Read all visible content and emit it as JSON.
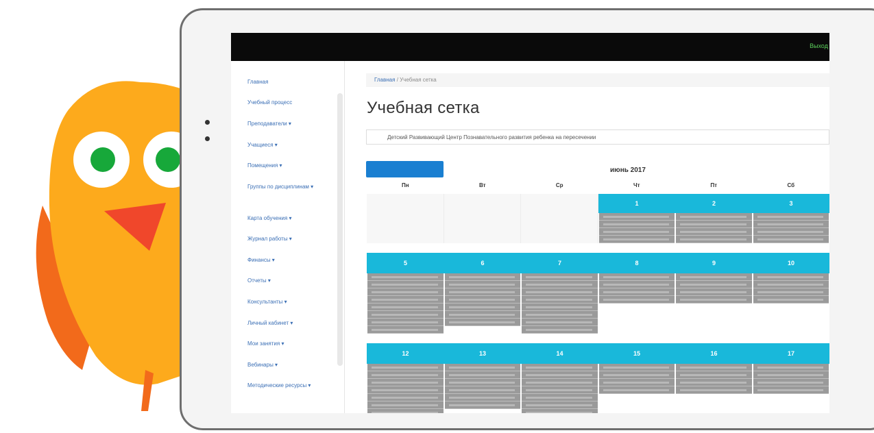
{
  "header": {
    "top_link": "Выход"
  },
  "sidebar": {
    "items": [
      {
        "label": "Главная"
      },
      {
        "label": "Учебный процесс"
      },
      {
        "label": "Преподаватели ▾"
      },
      {
        "label": "Учащиеся ▾"
      },
      {
        "label": "Помещения ▾"
      },
      {
        "label": "Группы по дисциплинам ▾"
      },
      {
        "label": "Карта обучения ▾"
      },
      {
        "label": "Журнал работы ▾"
      },
      {
        "label": "Финансы ▾"
      },
      {
        "label": "Отчеты ▾"
      },
      {
        "label": "Консультанты ▾"
      },
      {
        "label": "Личный кабинет ▾"
      },
      {
        "label": "Мои занятия ▾"
      },
      {
        "label": "Вебинары ▾"
      },
      {
        "label": "Методические ресурсы ▾"
      }
    ]
  },
  "breadcrumb": {
    "home": "Главная",
    "separator": "/",
    "current": "Учебная сетка"
  },
  "page": {
    "title": "Учебная сетка",
    "org_select": "Детский Развивающий Центр Познавательного развития ребенка на пересечении",
    "month": "июнь 2017"
  },
  "calendar": {
    "weekdays": [
      "Пн",
      "Вт",
      "Ср",
      "Чт",
      "Пт",
      "Сб"
    ],
    "weeks": [
      {
        "days": [
          "",
          "",
          "",
          "1",
          "2",
          "3"
        ]
      },
      {
        "days": [
          "5",
          "6",
          "7",
          "8",
          "9",
          "10"
        ]
      },
      {
        "days": [
          "12",
          "13",
          "14",
          "15",
          "16",
          "17"
        ]
      }
    ]
  },
  "colors": {
    "accent": "#19b8da",
    "button": "#1a7fd1",
    "event": "#9a9a9a",
    "topbar": "#0a0a0a"
  }
}
